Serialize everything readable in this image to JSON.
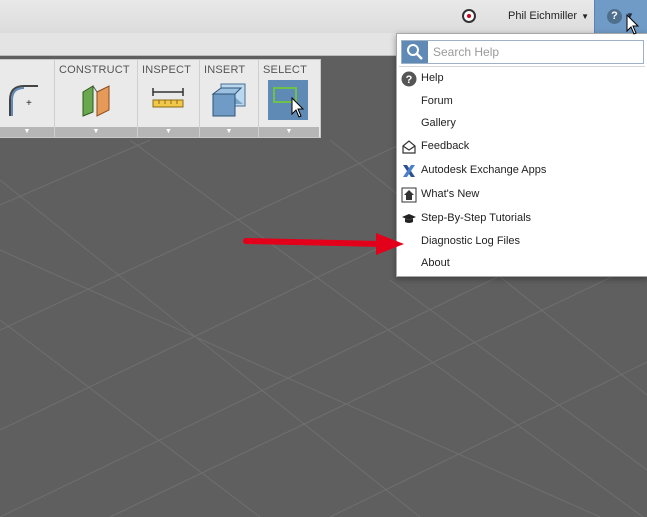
{
  "topbar": {
    "user_name": "Phil Eichmiller"
  },
  "toolbar": {
    "groups": [
      {
        "label": "CONSTRUCT"
      },
      {
        "label": "INSPECT"
      },
      {
        "label": "INSERT"
      },
      {
        "label": "SELECT"
      }
    ]
  },
  "help_menu": {
    "search_placeholder": "Search Help",
    "items": [
      {
        "label": "Help",
        "icon": "question-circle-icon"
      },
      {
        "label": "Forum",
        "icon": ""
      },
      {
        "label": "Gallery",
        "icon": ""
      },
      {
        "label": "Feedback",
        "icon": "feedback-icon"
      },
      {
        "label": "Autodesk Exchange Apps",
        "icon": "exchange-apps-icon"
      },
      {
        "label": "What's New",
        "icon": "home-icon"
      },
      {
        "label": "Step-By-Step Tutorials",
        "icon": "graduation-cap-icon"
      },
      {
        "label": "Diagnostic Log Files",
        "icon": ""
      },
      {
        "label": "About",
        "icon": ""
      }
    ]
  },
  "colors": {
    "viewport": "#5f5f5f",
    "help_button": "#6f9bc6",
    "arrow": "#e3001b"
  }
}
